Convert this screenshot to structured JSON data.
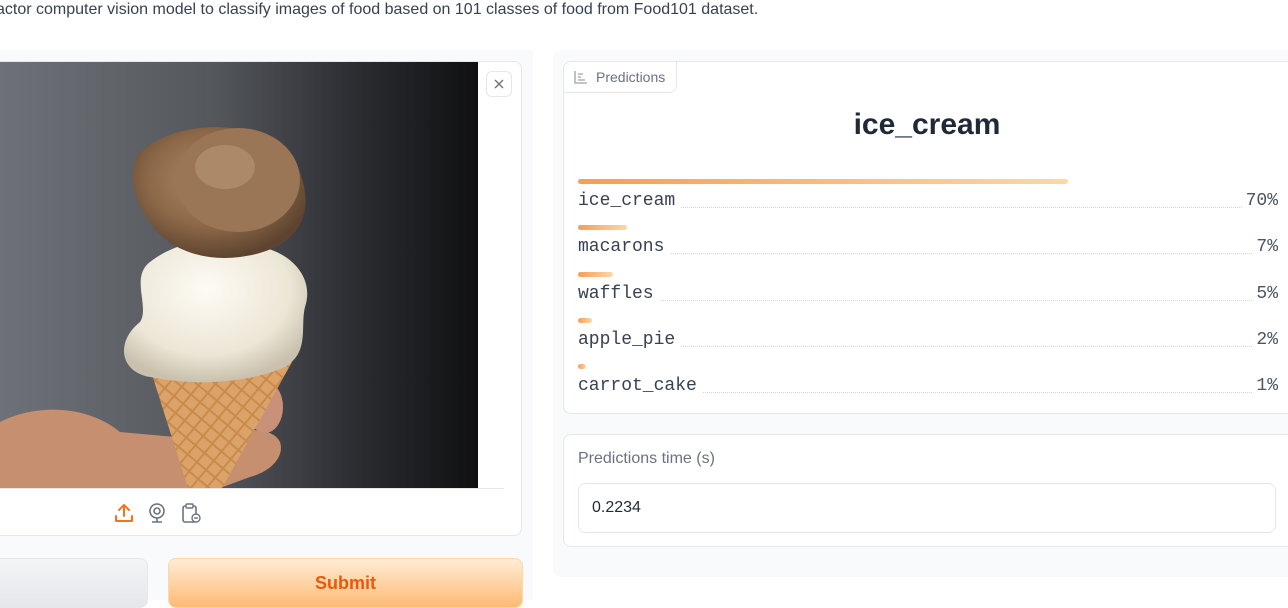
{
  "description": "actor computer vision model to classify images of food based on 101 classes of food from Food101 dataset.",
  "image_input": {
    "close_label": "×",
    "sources": [
      "upload-icon",
      "webcam-icon",
      "clipboard-icon"
    ]
  },
  "buttons": {
    "clear_label": "",
    "submit_label": "Submit"
  },
  "predictions": {
    "tag_label": "Predictions",
    "top_label": "ice_cream",
    "items": [
      {
        "label": "ice_cream",
        "confidence": "70%",
        "fraction": 0.7
      },
      {
        "label": "macarons",
        "confidence": "7%",
        "fraction": 0.07
      },
      {
        "label": "waffles",
        "confidence": "5%",
        "fraction": 0.05
      },
      {
        "label": "apple_pie",
        "confidence": "2%",
        "fraction": 0.02
      },
      {
        "label": "carrot_cake",
        "confidence": "1%",
        "fraction": 0.01
      }
    ]
  },
  "prediction_time": {
    "label": "Predictions time (s)",
    "value": "0.2234"
  },
  "colors": {
    "accent": "#f97316",
    "bar_start": "#f59e56",
    "bar_end": "#fdd7a8"
  }
}
